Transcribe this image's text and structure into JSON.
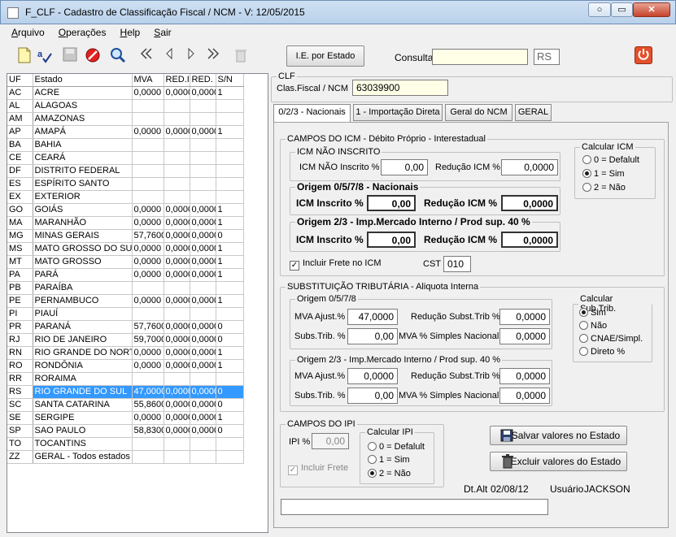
{
  "window": {
    "title": "F_CLF - Cadastro de Classificação Fiscal / NCM - V: 12/05/2015",
    "min_label": "○",
    "max_label": "▭",
    "close_label": "✕"
  },
  "menu": [
    "Arquivo",
    "Operações",
    "Help",
    "Sair"
  ],
  "toolbar": {
    "ie_button": "I.E. por Estado",
    "consulta_label": "Consulta",
    "consulta_value": "",
    "uf_value": "RS"
  },
  "grid": {
    "columns": [
      "UF",
      "Estado",
      "MVA",
      "RED.I",
      "RED.",
      "S/N"
    ],
    "rows": [
      [
        "AC",
        "ACRE",
        "0,0000",
        "0,0000",
        "0,0000",
        "1"
      ],
      [
        "AL",
        "ALAGOAS",
        "",
        "",
        "",
        ""
      ],
      [
        "AM",
        "AMAZONAS",
        "",
        "",
        "",
        ""
      ],
      [
        "AP",
        "AMAPÁ",
        "0,0000",
        "0,0000",
        "0,0000",
        "1"
      ],
      [
        "BA",
        "BAHIA",
        "",
        "",
        "",
        ""
      ],
      [
        "CE",
        "CEARÁ",
        "",
        "",
        "",
        ""
      ],
      [
        "DF",
        "DISTRITO FEDERAL",
        "",
        "",
        "",
        ""
      ],
      [
        "ES",
        "ESPÍRITO SANTO",
        "",
        "",
        "",
        ""
      ],
      [
        "EX",
        "EXTERIOR",
        "",
        "",
        "",
        ""
      ],
      [
        "GO",
        "GOIÁS",
        "0,0000",
        "0,0000",
        "0,0000",
        "1"
      ],
      [
        "MA",
        "MARANHÃO",
        "0,0000",
        "0,0000",
        "0,0000",
        "1"
      ],
      [
        "MG",
        "MINAS GERAIS",
        "57,7600",
        "0,0000",
        "0,0000",
        "0"
      ],
      [
        "MS",
        "MATO GROSSO DO SUL",
        "0,0000",
        "0,0000",
        "0,0000",
        "1"
      ],
      [
        "MT",
        "MATO GROSSO",
        "0,0000",
        "0,0000",
        "0,0000",
        "1"
      ],
      [
        "PA",
        "PARÁ",
        "0,0000",
        "0,0000",
        "0,0000",
        "1"
      ],
      [
        "PB",
        "PARAÍBA",
        "",
        "",
        "",
        ""
      ],
      [
        "PE",
        "PERNAMBUCO",
        "0,0000",
        "0,0000",
        "0,0000",
        "1"
      ],
      [
        "PI",
        "PIAUÍ",
        "",
        "",
        "",
        ""
      ],
      [
        "PR",
        "PARANÁ",
        "57,7600",
        "0,0000",
        "0,0000",
        "0"
      ],
      [
        "RJ",
        "RIO DE JANEIRO",
        "59,7000",
        "0,0000",
        "0,0000",
        "0"
      ],
      [
        "RN",
        "RIO GRANDE DO NORTE",
        "0,0000",
        "0,0000",
        "0,0000",
        "1"
      ],
      [
        "RO",
        "RONDÔNIA",
        "0,0000",
        "0,0000",
        "0,0000",
        "1"
      ],
      [
        "RR",
        "RORAIMA",
        "",
        "",
        "",
        ""
      ],
      [
        "RS",
        "RIO GRANDE DO SUL",
        "47,0000",
        "0,0000",
        "0,0000",
        "0"
      ],
      [
        "SC",
        "SANTA CATARINA",
        "55,8600",
        "0,0000",
        "0,0000",
        "0"
      ],
      [
        "SE",
        "SERGIPE",
        "0,0000",
        "0,0000",
        "0,0000",
        "1"
      ],
      [
        "SP",
        "SAO PAULO",
        "58,8300",
        "0,0000",
        "0,0000",
        "0"
      ],
      [
        "TO",
        "TOCANTINS",
        "",
        "",
        "",
        ""
      ],
      [
        "ZZ",
        "GERAL - Todos estados",
        "",
        "",
        "",
        ""
      ]
    ],
    "selected_index": 23
  },
  "clf": {
    "legend": "CLF",
    "label": "Clas.Fiscal / NCM",
    "value": "63039900"
  },
  "tabs": [
    "0/2/3 - Nacionais",
    "1 - Importação Direta",
    "Geral do NCM",
    "GERAL"
  ],
  "icm": {
    "legend": "CAMPOS DO ICM - Débito Próprio - Interestadual",
    "nao_inscrito": {
      "legend": "ICM NÃO INSCRITO",
      "icm_label": "ICM NÃO Inscrito %",
      "icm_value": "0,00",
      "red_label": "Redução ICM %",
      "red_value": "0,0000"
    },
    "origem0": {
      "legend": "Origem 0/5/7/8 - Nacionais",
      "icm_label": "ICM Inscrito %",
      "icm_value": "0,00",
      "red_label": "Redução ICM %",
      "red_value": "0,0000"
    },
    "origem2": {
      "legend": "Origem 2/3 - Imp.Mercado Interno / Prod sup. 40 %",
      "icm_label": "ICM Inscrito %",
      "icm_value": "0,00",
      "red_label": "Redução ICM %",
      "red_value": "0,0000"
    },
    "calc": {
      "legend": "Calcular ICM",
      "options": [
        "0 = Defalult",
        "1 = Sim",
        "2 = Não"
      ],
      "selected": 1
    },
    "frete_label": "Incluir Frete no ICM",
    "frete_check": "✓",
    "cst_label": "CST",
    "cst_value": "010"
  },
  "st": {
    "legend": "SUBSTITUIÇÃO TRIBUTÁRIA - Aliquota Interna",
    "origem0": {
      "legend": "Origem 0/5/7/8",
      "mva_label": "MVA Ajust.%",
      "mva_value": "47,0000",
      "red_label": "Redução Subst.Trib %",
      "red_value": "0,0000",
      "subs_label": "Subs.Trib. %",
      "subs_value": "0,00",
      "simples_label": "MVA % Simples Nacional",
      "simples_value": "0,0000"
    },
    "origem2": {
      "legend": "Origem 2/3 - Imp.Mercado Interno / Prod sup. 40 %",
      "mva_label": "MVA Ajust.%",
      "mva_value": "0,0000",
      "red_label": "Redução Subst.Trib %",
      "red_value": "0,0000",
      "subs_label": "Subs.Trib. %",
      "subs_value": "0,00",
      "simples_label": "MVA % Simples Nacional",
      "simples_value": "0,0000"
    },
    "calc": {
      "legend": "Calcular Sub.Trib.",
      "options": [
        "Sim",
        "Não",
        "CNAE/Simpl.",
        "Direto %"
      ],
      "selected": 0
    }
  },
  "ipi": {
    "legend": "CAMPOS DO IPI",
    "ipi_label": "IPI %",
    "ipi_value": "0,00",
    "frete_label": "Incluir Frete",
    "frete_check": "✓",
    "calc": {
      "legend": "Calcular IPI",
      "options": [
        "0 = Defalult",
        "1 = Sim",
        "2 = Não"
      ],
      "selected": 2
    }
  },
  "actions": {
    "save": "Salvar valores no Estado",
    "delete": "Excluir valores do Estado"
  },
  "footer": {
    "dt_label": "Dt.Alt",
    "dt_value": "02/08/12",
    "user_label": "Usuário",
    "user_value": "JACKSON",
    "status_value": ""
  },
  "colors": {
    "selection": "#3399ff",
    "highlight_input": "#ffffe8",
    "power_button": "#e2512c"
  }
}
